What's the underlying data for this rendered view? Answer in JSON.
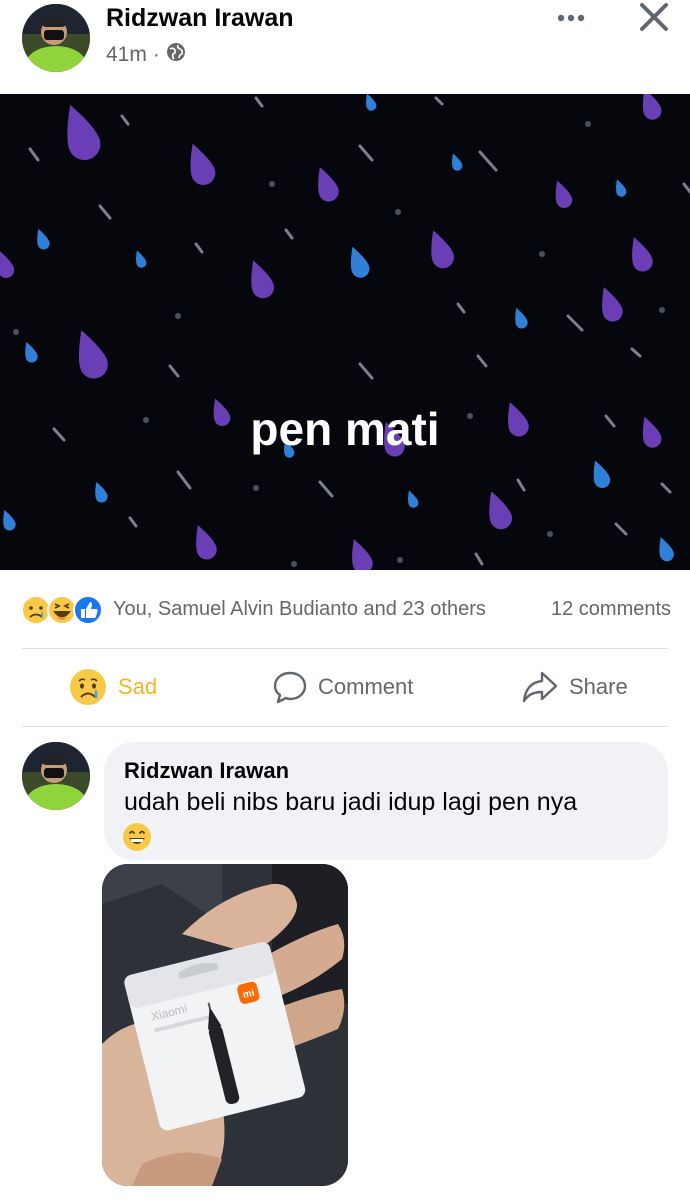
{
  "post": {
    "author_name": "Ridzwan Irawan",
    "time": "41m",
    "separator": "·",
    "privacy_icon": "globe-icon",
    "more_icon": "more-horizontal-icon",
    "close_icon": "close-icon",
    "text": "pen mati",
    "background": "#05070d"
  },
  "reactions": {
    "icons": [
      "sad-reaction-icon",
      "haha-reaction-icon",
      "like-reaction-icon"
    ],
    "reactors_text": "You, Samuel Alvin Budianto and 23 others",
    "comments_count": "12 comments"
  },
  "actions": {
    "sad_label": "Sad",
    "comment_label": "Comment",
    "share_label": "Share",
    "sad_color": "#f0b429"
  },
  "comment": {
    "author_name": "Ridzwan Irawan",
    "text": "udah beli nibs baru jadi idup lagi pen nya",
    "emoji": "grinning-face-icon",
    "photo_brand": "mi",
    "photo_box_text": "Xiaomi"
  }
}
